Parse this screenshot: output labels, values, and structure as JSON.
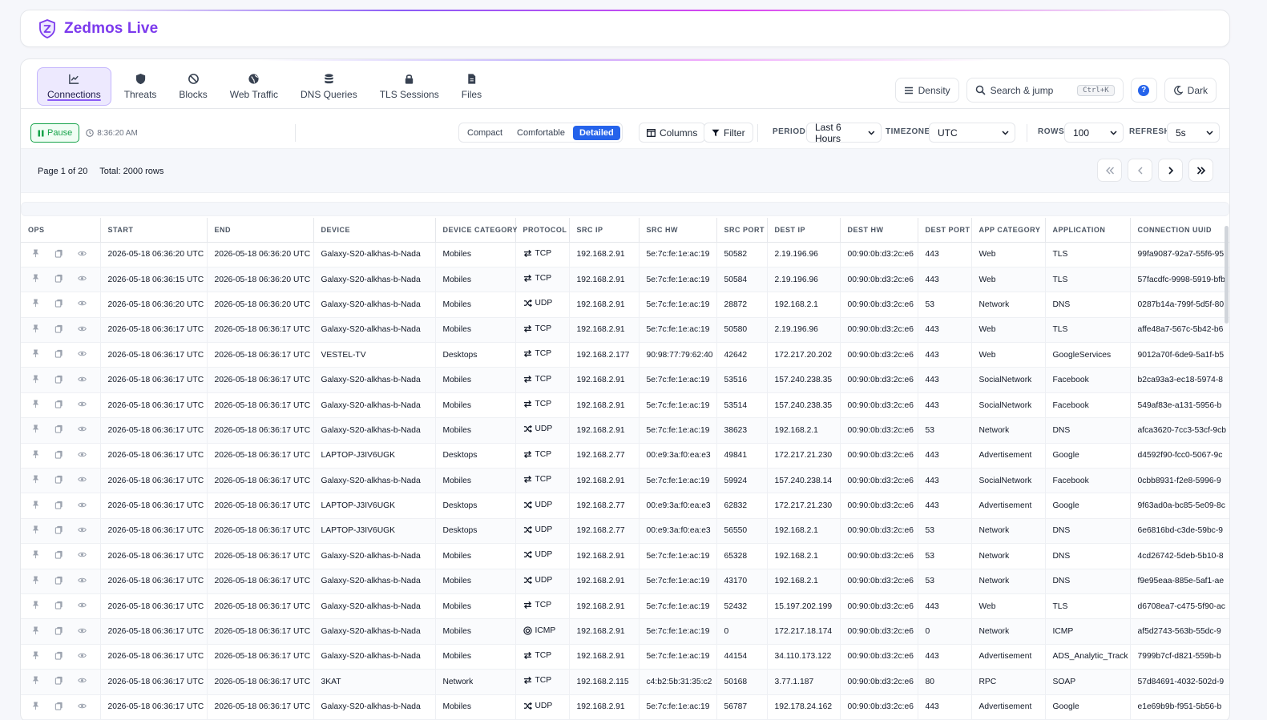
{
  "app": {
    "title": "Zedmos Live"
  },
  "tabs": [
    {
      "label": "Connections",
      "icon": "chart-line-icon",
      "active": true
    },
    {
      "label": "Threats",
      "icon": "shield-icon",
      "active": false
    },
    {
      "label": "Blocks",
      "icon": "ban-icon",
      "active": false
    },
    {
      "label": "Web Traffic",
      "icon": "globe-icon",
      "active": false
    },
    {
      "label": "DNS Queries",
      "icon": "database-icon",
      "active": false
    },
    {
      "label": "TLS Sessions",
      "icon": "lock-icon",
      "active": false
    },
    {
      "label": "Files",
      "icon": "file-icon",
      "active": false
    }
  ],
  "top_right": {
    "density_label": "Density",
    "search_placeholder": "Search & jump",
    "search_shortcut": "Ctrl+K",
    "help_label": "?",
    "theme_label": "Dark"
  },
  "toolbar": {
    "pause_label": "Pause",
    "time": "8:36:20 AM",
    "density_options": [
      "Compact",
      "Comfortable",
      "Detailed"
    ],
    "density_selected": "Detailed",
    "columns_label": "Columns",
    "filter_label": "Filter",
    "period_label": "PERIOD",
    "period_value": "Last 6 Hours",
    "timezone_label": "TIMEZONE",
    "timezone_value": "UTC",
    "rows_label": "ROWS",
    "rows_value": "100",
    "refresh_label": "REFRESH",
    "refresh_value": "5s"
  },
  "pager": {
    "page_text": "Page 1 of 20",
    "total_text": "Total: 2000 rows"
  },
  "colors": {
    "accent": "#7c3aed",
    "primary": "#2563eb",
    "success": "#16a34a"
  },
  "table": {
    "columns": [
      "OPS",
      "START",
      "END",
      "DEVICE",
      "DEVICE CATEGORY",
      "PROTOCOL",
      "SRC IP",
      "SRC HW",
      "SRC PORT",
      "DEST IP",
      "DEST HW",
      "DEST PORT",
      "APP CATEGORY",
      "APPLICATION",
      "CONNECTION UUID"
    ],
    "rows": [
      [
        "2026-05-18 06:36:20 UTC",
        "2026-05-18 06:36:20 UTC",
        "Galaxy-S20-alkhas-b-Nada",
        "Mobiles",
        "TCP",
        "192.168.2.91",
        "5e:7c:fe:1e:ac:19",
        "50582",
        "2.19.196.96",
        "00:90:0b:d3:2c:e6",
        "443",
        "Web",
        "TLS",
        "99fa9087-92a7-55f6-95"
      ],
      [
        "2026-05-18 06:36:15 UTC",
        "2026-05-18 06:36:20 UTC",
        "Galaxy-S20-alkhas-b-Nada",
        "Mobiles",
        "TCP",
        "192.168.2.91",
        "5e:7c:fe:1e:ac:19",
        "50584",
        "2.19.196.96",
        "00:90:0b:d3:2c:e6",
        "443",
        "Web",
        "TLS",
        "57facdfc-9998-5919-bfb"
      ],
      [
        "2026-05-18 06:36:20 UTC",
        "2026-05-18 06:36:20 UTC",
        "Galaxy-S20-alkhas-b-Nada",
        "Mobiles",
        "UDP",
        "192.168.2.91",
        "5e:7c:fe:1e:ac:19",
        "28872",
        "192.168.2.1",
        "00:90:0b:d3:2c:e6",
        "53",
        "Network",
        "DNS",
        "0287b14a-799f-5d5f-80"
      ],
      [
        "2026-05-18 06:36:17 UTC",
        "2026-05-18 06:36:17 UTC",
        "Galaxy-S20-alkhas-b-Nada",
        "Mobiles",
        "TCP",
        "192.168.2.91",
        "5e:7c:fe:1e:ac:19",
        "50580",
        "2.19.196.96",
        "00:90:0b:d3:2c:e6",
        "443",
        "Web",
        "TLS",
        "affe48a7-567c-5b42-b6"
      ],
      [
        "2026-05-18 06:36:17 UTC",
        "2026-05-18 06:36:17 UTC",
        "VESTEL-TV",
        "Desktops",
        "TCP",
        "192.168.2.177",
        "90:98:77:79:62:40",
        "42642",
        "172.217.20.202",
        "00:90:0b:d3:2c:e6",
        "443",
        "Web",
        "GoogleServices",
        "9012a70f-6de9-5a1f-b5"
      ],
      [
        "2026-05-18 06:36:17 UTC",
        "2026-05-18 06:36:17 UTC",
        "Galaxy-S20-alkhas-b-Nada",
        "Mobiles",
        "TCP",
        "192.168.2.91",
        "5e:7c:fe:1e:ac:19",
        "53516",
        "157.240.238.35",
        "00:90:0b:d3:2c:e6",
        "443",
        "SocialNetwork",
        "Facebook",
        "b2ca93a3-ec18-5974-8"
      ],
      [
        "2026-05-18 06:36:17 UTC",
        "2026-05-18 06:36:17 UTC",
        "Galaxy-S20-alkhas-b-Nada",
        "Mobiles",
        "TCP",
        "192.168.2.91",
        "5e:7c:fe:1e:ac:19",
        "53514",
        "157.240.238.35",
        "00:90:0b:d3:2c:e6",
        "443",
        "SocialNetwork",
        "Facebook",
        "549af83e-a131-5956-b"
      ],
      [
        "2026-05-18 06:36:17 UTC",
        "2026-05-18 06:36:17 UTC",
        "Galaxy-S20-alkhas-b-Nada",
        "Mobiles",
        "UDP",
        "192.168.2.91",
        "5e:7c:fe:1e:ac:19",
        "38623",
        "192.168.2.1",
        "00:90:0b:d3:2c:e6",
        "53",
        "Network",
        "DNS",
        "afca3620-7cc3-53cf-9cb"
      ],
      [
        "2026-05-18 06:36:17 UTC",
        "2026-05-18 06:36:17 UTC",
        "LAPTOP-J3IV6UGK",
        "Desktops",
        "TCP",
        "192.168.2.77",
        "00:e9:3a:f0:ea:e3",
        "49841",
        "172.217.21.230",
        "00:90:0b:d3:2c:e6",
        "443",
        "Advertisement",
        "Google",
        "d4592f90-fcc0-5067-9c"
      ],
      [
        "2026-05-18 06:36:17 UTC",
        "2026-05-18 06:36:17 UTC",
        "Galaxy-S20-alkhas-b-Nada",
        "Mobiles",
        "TCP",
        "192.168.2.91",
        "5e:7c:fe:1e:ac:19",
        "59924",
        "157.240.238.14",
        "00:90:0b:d3:2c:e6",
        "443",
        "SocialNetwork",
        "Facebook",
        "0cbb8931-f2e8-5996-9"
      ],
      [
        "2026-05-18 06:36:17 UTC",
        "2026-05-18 06:36:17 UTC",
        "LAPTOP-J3IV6UGK",
        "Desktops",
        "UDP",
        "192.168.2.77",
        "00:e9:3a:f0:ea:e3",
        "62832",
        "172.217.21.230",
        "00:90:0b:d3:2c:e6",
        "443",
        "Advertisement",
        "Google",
        "9f63ad0a-bc85-5e09-8c"
      ],
      [
        "2026-05-18 06:36:17 UTC",
        "2026-05-18 06:36:17 UTC",
        "LAPTOP-J3IV6UGK",
        "Desktops",
        "UDP",
        "192.168.2.77",
        "00:e9:3a:f0:ea:e3",
        "56550",
        "192.168.2.1",
        "00:90:0b:d3:2c:e6",
        "53",
        "Network",
        "DNS",
        "6e6816bd-c3de-59bc-9"
      ],
      [
        "2026-05-18 06:36:17 UTC",
        "2026-05-18 06:36:17 UTC",
        "Galaxy-S20-alkhas-b-Nada",
        "Mobiles",
        "UDP",
        "192.168.2.91",
        "5e:7c:fe:1e:ac:19",
        "65328",
        "192.168.2.1",
        "00:90:0b:d3:2c:e6",
        "53",
        "Network",
        "DNS",
        "4cd26742-5deb-5b10-8"
      ],
      [
        "2026-05-18 06:36:17 UTC",
        "2026-05-18 06:36:17 UTC",
        "Galaxy-S20-alkhas-b-Nada",
        "Mobiles",
        "UDP",
        "192.168.2.91",
        "5e:7c:fe:1e:ac:19",
        "43170",
        "192.168.2.1",
        "00:90:0b:d3:2c:e6",
        "53",
        "Network",
        "DNS",
        "f9e95eaa-885e-5af1-ae"
      ],
      [
        "2026-05-18 06:36:17 UTC",
        "2026-05-18 06:36:17 UTC",
        "Galaxy-S20-alkhas-b-Nada",
        "Mobiles",
        "TCP",
        "192.168.2.91",
        "5e:7c:fe:1e:ac:19",
        "52432",
        "15.197.202.199",
        "00:90:0b:d3:2c:e6",
        "443",
        "Web",
        "TLS",
        "d6708ea7-c475-5f90-ac"
      ],
      [
        "2026-05-18 06:36:17 UTC",
        "2026-05-18 06:36:17 UTC",
        "Galaxy-S20-alkhas-b-Nada",
        "Mobiles",
        "ICMP",
        "192.168.2.91",
        "5e:7c:fe:1e:ac:19",
        "0",
        "172.217.18.174",
        "00:90:0b:d3:2c:e6",
        "0",
        "Network",
        "ICMP",
        "af5d2743-563b-55dc-9"
      ],
      [
        "2026-05-18 06:36:17 UTC",
        "2026-05-18 06:36:17 UTC",
        "Galaxy-S20-alkhas-b-Nada",
        "Mobiles",
        "TCP",
        "192.168.2.91",
        "5e:7c:fe:1e:ac:19",
        "44154",
        "34.110.173.122",
        "00:90:0b:d3:2c:e6",
        "443",
        "Advertisement",
        "ADS_Analytic_Track",
        "7999b7cf-d821-559b-b"
      ],
      [
        "2026-05-18 06:36:17 UTC",
        "2026-05-18 06:36:17 UTC",
        "3KAT",
        "Network",
        "TCP",
        "192.168.2.115",
        "c4:b2:5b:31:35:c2",
        "50168",
        "3.77.1.187",
        "00:90:0b:d3:2c:e6",
        "80",
        "RPC",
        "SOAP",
        "57d84691-4032-502d-9"
      ],
      [
        "2026-05-18 06:36:17 UTC",
        "2026-05-18 06:36:17 UTC",
        "Galaxy-S20-alkhas-b-Nada",
        "Mobiles",
        "UDP",
        "192.168.2.91",
        "5e:7c:fe:1e:ac:19",
        "56787",
        "192.178.24.162",
        "00:90:0b:d3:2c:e6",
        "443",
        "Advertisement",
        "Google",
        "e1e69b9b-f951-5b56-b"
      ]
    ]
  }
}
